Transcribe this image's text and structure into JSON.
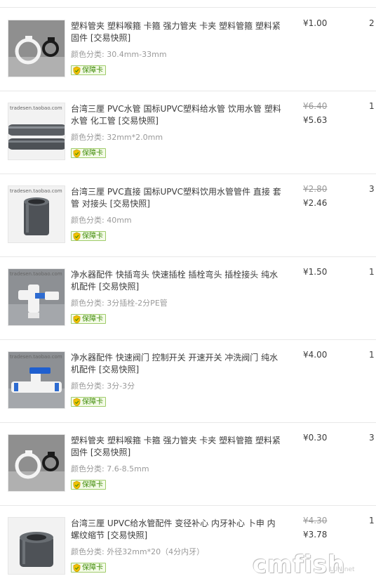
{
  "sku_label": "颜色分类:",
  "badge_label": "保障卡",
  "items": [
    {
      "title": "塑料管夹 塑料喉箍 卡箍 强力管夹 卡夹 塑料管箍 塑料紧固件 [交易快照]",
      "sku": "30.4mm-33mm",
      "original_price": "",
      "price": "¥1.00",
      "qty": "2"
    },
    {
      "title": "台湾三厘 PVC水管 国标UPVC塑料给水管 饮用水管 塑料水管 化工管 [交易快照]",
      "sku": "32mm*2.0mm",
      "original_price": "¥6.40",
      "price": "¥5.63",
      "qty": "1",
      "thumb_text": "tradesen.taobao.com"
    },
    {
      "title": "台湾三厘 PVC直接 国标UPVC塑料饮用水管管件 直接 套管 对接头 [交易快照]",
      "sku": "40mm",
      "original_price": "¥2.80",
      "price": "¥2.46",
      "qty": "3",
      "thumb_text": "tradesen.taobao.com"
    },
    {
      "title": "净水器配件 快插弯头 快速插栓 插栓弯头 插栓接头 纯水机配件 [交易快照]",
      "sku": "3分插栓-2分PE管",
      "original_price": "",
      "price": "¥1.50",
      "qty": "1",
      "thumb_text": "tradesen.taobao.com"
    },
    {
      "title": "净水器配件 快速阀门 控制开关 开速开关 冲洗阀门 纯水机配件 [交易快照]",
      "sku": "3分-3分",
      "original_price": "",
      "price": "¥4.00",
      "qty": "1",
      "thumb_text": "tradesen.taobao.com"
    },
    {
      "title": "塑料管夹 塑料喉箍 卡箍 强力管夹 卡夹 塑料管箍 塑料紧固件 [交易快照]",
      "sku": "7.6-8.5mm",
      "original_price": "",
      "price": "¥0.30",
      "qty": "3"
    },
    {
      "title": "台湾三厘 UPVC给水管配件 变径补心 内牙补心 卜申 内螺纹缩节 [交易快照]",
      "sku": "外径32mm*20（4分内牙）",
      "original_price": "¥4.30",
      "price": "¥3.78",
      "qty": "1"
    }
  ],
  "watermark": "cmfish",
  "watermark_sub": "LUN.net"
}
